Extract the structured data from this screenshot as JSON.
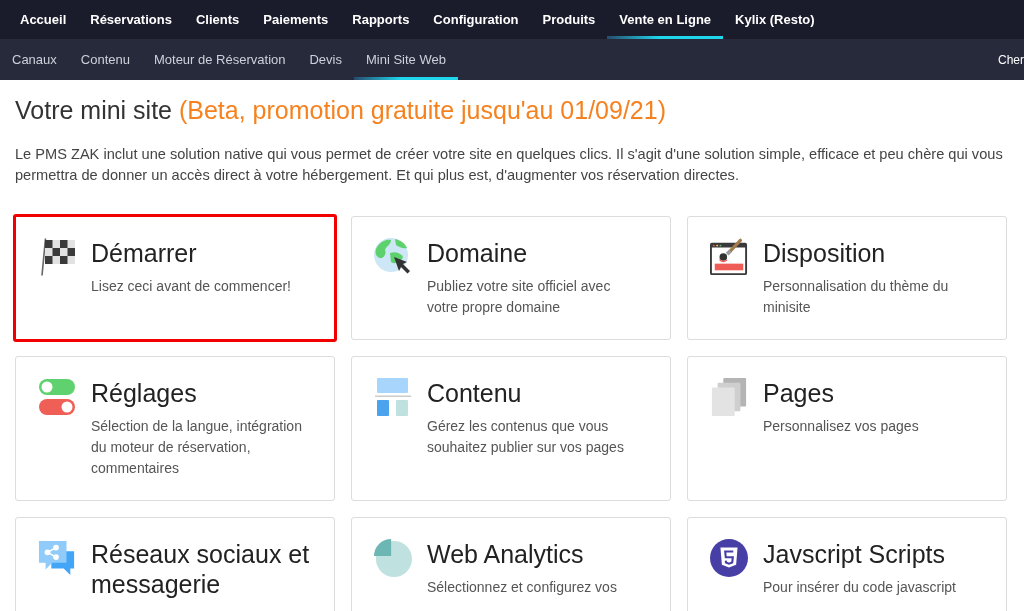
{
  "top_nav": {
    "items": [
      {
        "label": "Accueil",
        "selected": false
      },
      {
        "label": "Réservations",
        "selected": false
      },
      {
        "label": "Clients",
        "selected": false
      },
      {
        "label": "Paiements",
        "selected": false
      },
      {
        "label": "Rapports",
        "selected": false
      },
      {
        "label": "Configuration",
        "selected": false
      },
      {
        "label": "Produits",
        "selected": false
      },
      {
        "label": "Vente en Ligne",
        "selected": true
      },
      {
        "label": "Kylix (Resto)",
        "selected": false
      }
    ]
  },
  "sub_nav": {
    "items": [
      {
        "label": "Canaux",
        "selected": false
      },
      {
        "label": "Contenu",
        "selected": false
      },
      {
        "label": "Moteur de Réservation",
        "selected": false
      },
      {
        "label": "Devis",
        "selected": false
      },
      {
        "label": "Mini Site Web",
        "selected": true
      }
    ],
    "search_label": "Cher"
  },
  "page": {
    "title": "Votre mini site",
    "title_note": "(Beta, promotion gratuite jusqu'au 01/09/21)",
    "intro": "Le PMS ZAK inclut une solution native qui vous permet de créer votre site en quelques clics. Il s'agit d'une solution simple, efficace et peu chère qui vous permettra de donner un accès direct à votre hébergement. Et qui plus est, d'augmenter vos réservation directes."
  },
  "cards": [
    {
      "title": "Démarrer",
      "description": "Lisez ceci avant de commencer!",
      "selected": true
    },
    {
      "title": "Domaine",
      "description": "Publiez votre site officiel avec votre propre domaine",
      "selected": false
    },
    {
      "title": "Disposition",
      "description": "Personnalisation du thème du minisite",
      "selected": false
    },
    {
      "title": "Réglages",
      "description": "Sélection de la langue, intégration du moteur de réservation, commentaires",
      "selected": false
    },
    {
      "title": "Contenu",
      "description": "Gérez les contenus que vous souhaitez publier sur vos pages",
      "selected": false
    },
    {
      "title": "Pages",
      "description": "Personnalisez vos pages",
      "selected": false
    },
    {
      "title": "Réseaux sociaux et messagerie",
      "selected": false
    },
    {
      "title": "Web Analytics",
      "description": "Sélectionnez et configurez vos",
      "selected": false
    },
    {
      "title": "Javscript Scripts",
      "description": "Pour insérer du code javascript",
      "selected": false
    }
  ]
}
